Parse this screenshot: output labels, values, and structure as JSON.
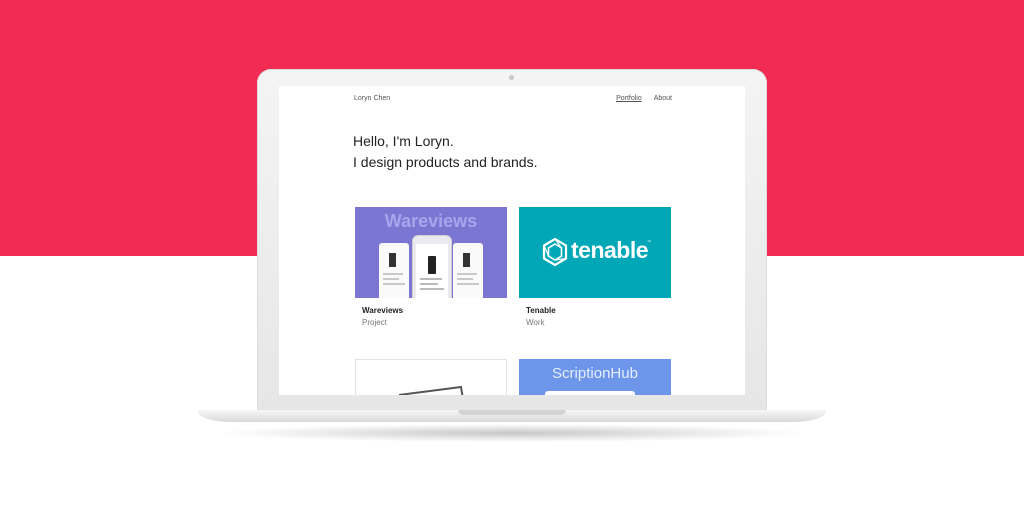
{
  "colors": {
    "background_top": "#f22b54",
    "background_bottom": "#ffffff"
  },
  "site": {
    "name": "Loryn Chen",
    "nav": [
      {
        "label": "Portfolio",
        "active": true
      },
      {
        "label": "About",
        "active": false
      }
    ],
    "hero": {
      "line1": "Hello, I'm Loryn.",
      "line2": "I design products and brands."
    },
    "cards": [
      {
        "title": "Wareviews",
        "subtitle": "Project",
        "thumb_text": "Wareviews",
        "thumb_color": "#7b76d2"
      },
      {
        "title": "Tenable",
        "subtitle": "Work",
        "thumb_text": "tenable",
        "thumb_color": "#00a8b7"
      },
      {
        "title": "",
        "subtitle": "",
        "thumb_text": "",
        "thumb_color": "#ffffff"
      },
      {
        "title": "",
        "subtitle": "",
        "thumb_text": "ScriptionHub",
        "thumb_color": "#6d95ea"
      }
    ]
  }
}
